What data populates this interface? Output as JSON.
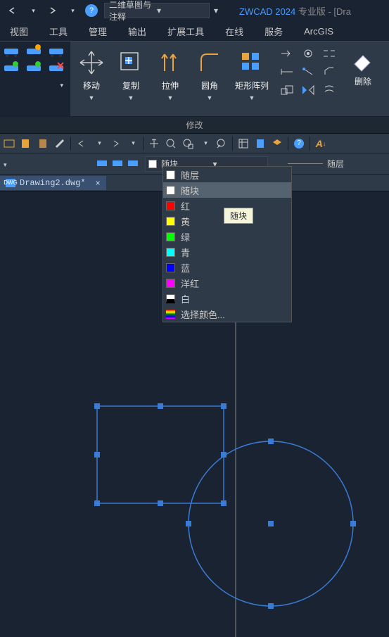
{
  "titlebar": {
    "workspace": "二维草图与注释",
    "app_title_brand": "ZWCAD 2024",
    "app_title_rest": " 专业版 - [Dra"
  },
  "menubar": {
    "items": [
      "视图",
      "工具",
      "管理",
      "输出",
      "扩展工具",
      "在线",
      "服务",
      "ArcGIS"
    ]
  },
  "ribbon": {
    "move": "移动",
    "copy": "复制",
    "stretch": "拉伸",
    "fillet": "圆角",
    "array": "矩形阵列",
    "erase": "删除"
  },
  "section_label": "修改",
  "toolbar3": {
    "color_sel": "随块",
    "layer_label": "随层"
  },
  "tab": {
    "filename": "Drawing2.dwg*",
    "close": "×"
  },
  "dropdown": {
    "bylayer": "随层",
    "byblock": "随块",
    "red": "红",
    "yellow": "黄",
    "green": "绿",
    "cyan": "青",
    "blue": "蓝",
    "magenta": "洋红",
    "white": "白",
    "more": "选择颜色..."
  },
  "tooltip": "随块"
}
